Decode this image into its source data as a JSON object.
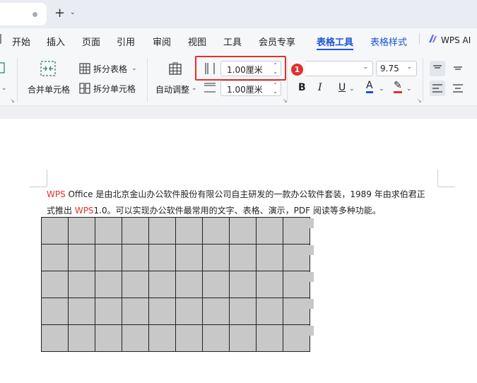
{
  "tabstrip": {
    "new_tab": "+",
    "new_tab_dropdown": "⌄"
  },
  "menu": {
    "items": [
      "开始",
      "插入",
      "页面",
      "引用",
      "审阅",
      "视图",
      "工具",
      "会员专享",
      "表格工具",
      "表格样式",
      "WPS AI"
    ],
    "active": "表格工具"
  },
  "ribbon": {
    "merge_cells": "合并单元格",
    "split_table": "拆分表格",
    "split_cells": "拆分单元格",
    "auto_fit": "自动调整",
    "col_width": "1.00厘米",
    "row_height": "1.00厘米",
    "font_size": "9.75",
    "badge": "1",
    "bold": "B",
    "italic": "I",
    "underline": "U",
    "font_color": "A",
    "highlight": "✎"
  },
  "document": {
    "paragraph": [
      [
        {
          "t": "WPS",
          "red": true
        },
        {
          "t": " Office 是由北京金山办公软件股份有限公司自主研发的一款办公软件套装，1989 年由求伯君正"
        }
      ],
      [
        {
          "t": "式推出 "
        },
        {
          "t": "WPS",
          "red": true
        },
        {
          "t": "1.0。可以实现办公软件最常用的文字、表格、演示，PDF 阅读等多种功能。"
        }
      ]
    ],
    "table": {
      "rows": 5,
      "cols": 10
    }
  },
  "colors": {
    "accent": "#1a54d6",
    "highlight": "#e0322e",
    "cell_fill": "#c8c8c8"
  }
}
